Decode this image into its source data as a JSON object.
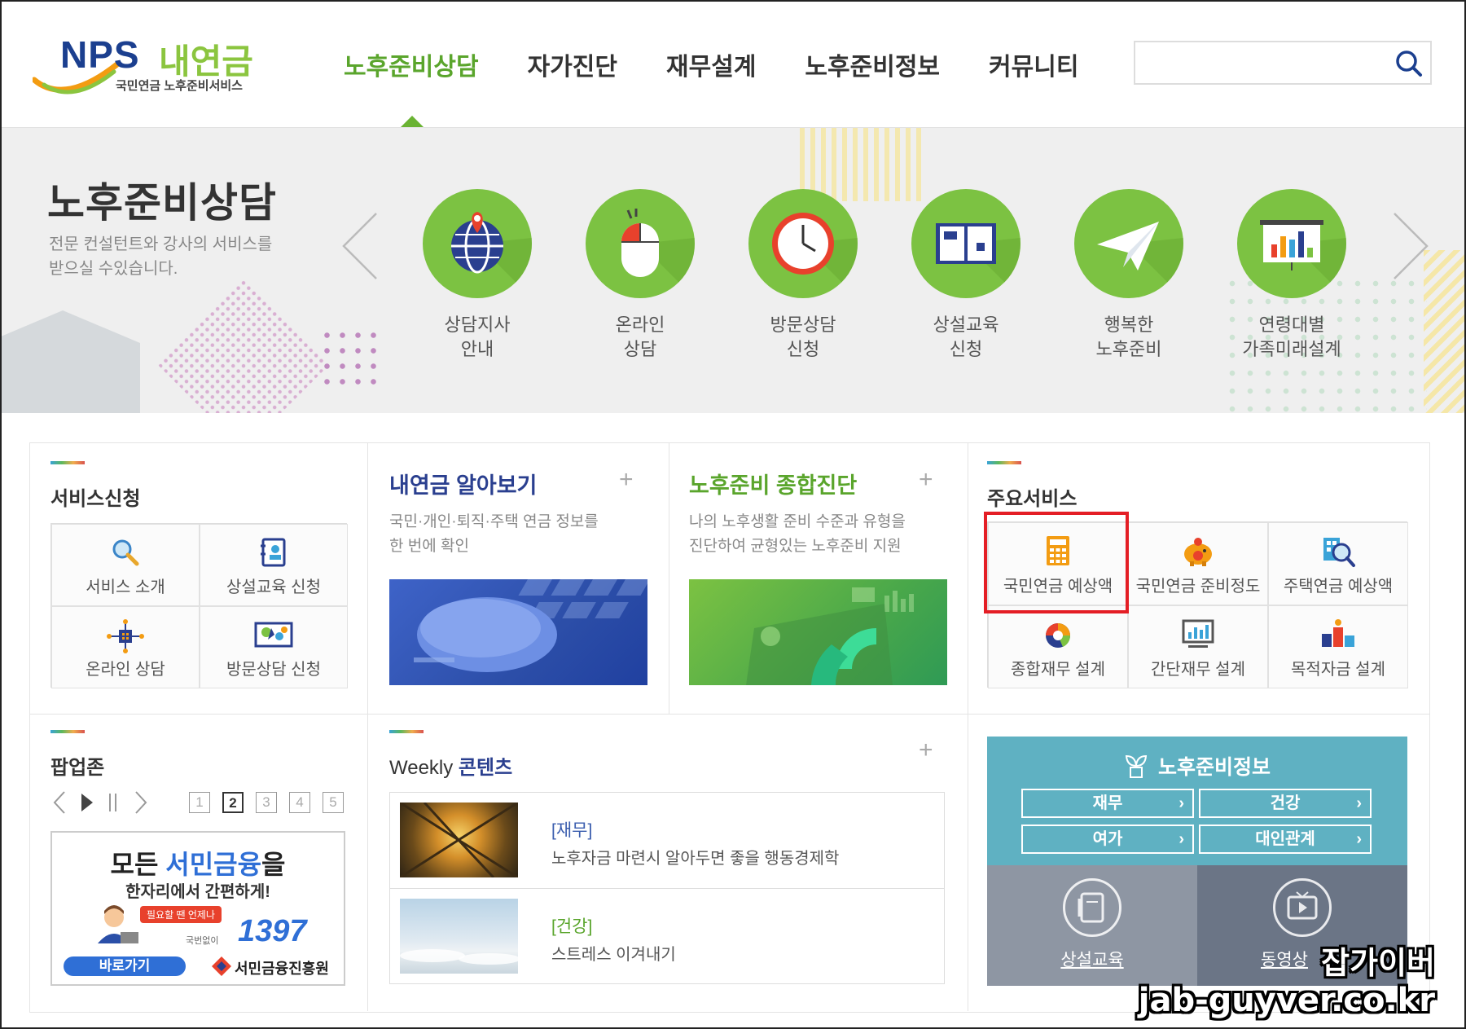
{
  "header": {
    "logo": {
      "brand": "NPS",
      "name": "내연금",
      "subtitle": "국민연금 노후준비서비스"
    },
    "nav": [
      "노후준비상담",
      "자가진단",
      "재무설계",
      "노후준비정보",
      "커뮤니티"
    ],
    "active_nav": "노후준비상담",
    "search": {
      "placeholder": ""
    }
  },
  "banner": {
    "title": "노후준비상담",
    "desc": "전문 컨설턴트와 강사의 서비스를 받으실 수있습니다.",
    "services": [
      {
        "label": "상담지사\n안내",
        "icon": "globe-pin-icon"
      },
      {
        "label": "온라인\n상담",
        "icon": "mouse-icon"
      },
      {
        "label": "방문상담\n신청",
        "icon": "clock-icon"
      },
      {
        "label": "상설교육\n신청",
        "icon": "book-icon"
      },
      {
        "label": "행복한\n노후준비",
        "icon": "paper-plane-icon"
      },
      {
        "label": "연령대별\n가족미래설계",
        "icon": "presentation-chart-icon"
      }
    ]
  },
  "service_request": {
    "title": "서비스신청",
    "items": [
      {
        "label": "서비스 소개",
        "icon": "magnifier-icon"
      },
      {
        "label": "상설교육 신청",
        "icon": "address-book-icon"
      },
      {
        "label": "온라인 상담",
        "icon": "network-icon"
      },
      {
        "label": "방문상담 신청",
        "icon": "map-icon"
      }
    ]
  },
  "my_pension": {
    "title": "내연금 알아보기",
    "desc": "국민·개인·퇴직·주택 연금 정보를\n한 번에 확인",
    "more": "+"
  },
  "diagnosis": {
    "title": "노후준비 종합진단",
    "desc": "나의 노후생활 준비 수준과 유형을\n진단하여 균형있는 노후준비 지원",
    "more": "+"
  },
  "main_services": {
    "title": "주요서비스",
    "items": [
      {
        "label": "국민연금 예상액",
        "icon": "calculator-icon",
        "highlighted": true
      },
      {
        "label": "국민연금 준비정도",
        "icon": "piggy-bank-icon"
      },
      {
        "label": "주택연금 예상액",
        "icon": "house-search-icon"
      },
      {
        "label": "종합재무 설계",
        "icon": "pie-chart-icon"
      },
      {
        "label": "간단재무 설계",
        "icon": "monitor-chart-icon"
      },
      {
        "label": "목적자금 설계",
        "icon": "money-bags-icon"
      }
    ]
  },
  "popup_zone": {
    "title": "팝업존",
    "pages": [
      "1",
      "2",
      "3",
      "4",
      "5"
    ],
    "current_page": "2",
    "ad": {
      "line1_a": "모든 ",
      "line1_b": "서민금융",
      "line1_c": "을",
      "line2": "한자리에서 간편하게!",
      "bubble": "필요할 땐 언제나",
      "phone_prefix": "국번없이",
      "phone": "1397",
      "button": "바로가기",
      "org": "서민금융진흥원"
    }
  },
  "weekly": {
    "title_en": "Weekly",
    "title_ko": "콘텐츠",
    "more": "+",
    "items": [
      {
        "tag": "[재무]",
        "text": "노후자금 마련시 알아두면 좋을 행동경제학",
        "tag_color": "#3a5dae"
      },
      {
        "tag": "[건강]",
        "text": "스트레스 이겨내기",
        "tag_color": "#5aa52c"
      }
    ]
  },
  "retirement_info": {
    "title": "노후준비정보",
    "buttons": [
      "재무",
      "건강",
      "여가",
      "대인관계"
    ],
    "links": [
      {
        "label": "상설교육",
        "icon": "book-icon"
      },
      {
        "label": "동영상",
        "icon": "video-icon"
      }
    ]
  },
  "watermark": {
    "line1": "잡가이버",
    "line2": "jab-guyver.co.kr"
  },
  "colors": {
    "accent_green": "#5aa52c",
    "navy": "#2a3f8f",
    "teal": "#5fb1c2",
    "highlight_red": "#e41e25"
  }
}
